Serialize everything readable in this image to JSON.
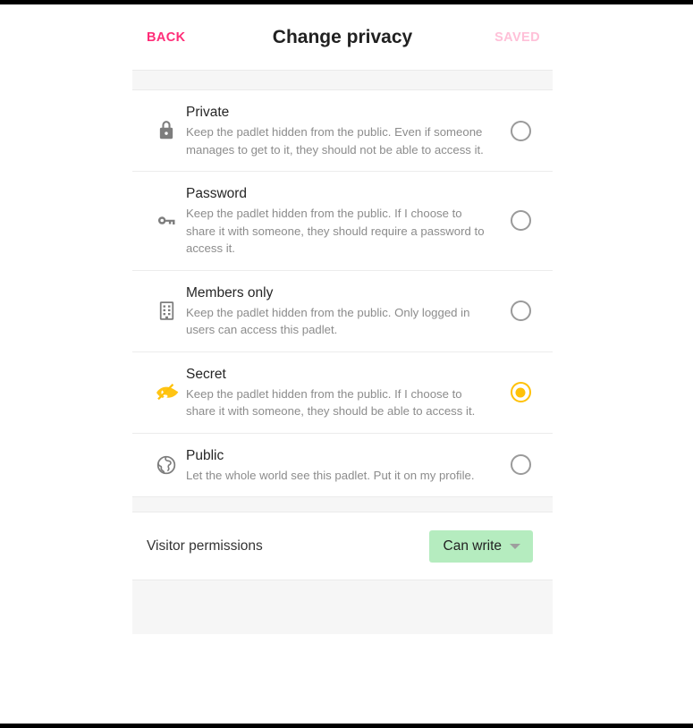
{
  "header": {
    "back_label": "BACK",
    "title": "Change privacy",
    "saved_label": "SAVED",
    "back_color": "#ff2d78",
    "saved_color": "#ffc0d8"
  },
  "privacy_options": [
    {
      "icon": "lock-icon",
      "title": "Private",
      "description": "Keep the padlet hidden from the public. Even if someone manages to get to it, they should not be able to access it.",
      "selected": false
    },
    {
      "icon": "key-icon",
      "title": "Password",
      "description": "Keep the padlet hidden from the public. If I choose to share it with someone, they should require a password to access it.",
      "selected": false
    },
    {
      "icon": "building-icon",
      "title": "Members only",
      "description": "Keep the padlet hidden from the public. Only logged in users can access this padlet.",
      "selected": false
    },
    {
      "icon": "eye-off-icon",
      "title": "Secret",
      "description": "Keep the padlet hidden from the public. If I choose to share it with someone, they should be able to access it.",
      "selected": true
    },
    {
      "icon": "globe-icon",
      "title": "Public",
      "description": "Let the whole world see this padlet. Put it on my profile.",
      "selected": false
    }
  ],
  "visitor_permissions": {
    "label": "Visitor permissions",
    "value": "Can write",
    "chip_color": "#b5ecbf"
  },
  "colors": {
    "accent_selected": "#ffc107",
    "icon_grey": "#7d7d7d",
    "brand_pink": "#ff2d78"
  }
}
